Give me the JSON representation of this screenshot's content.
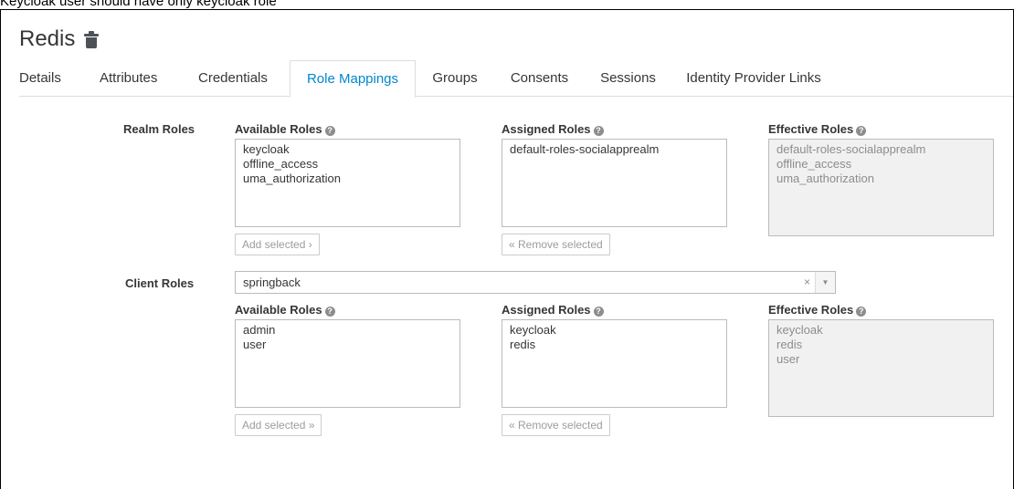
{
  "caption": "Keycloak user should have only keycloak role",
  "header": {
    "title": "Redis",
    "delete_icon": "trash-icon"
  },
  "tabs": [
    {
      "label": "Details",
      "active": false
    },
    {
      "label": "Attributes",
      "active": false
    },
    {
      "label": "Credentials",
      "active": false
    },
    {
      "label": "Role Mappings",
      "active": true
    },
    {
      "label": "Groups",
      "active": false
    },
    {
      "label": "Consents",
      "active": false
    },
    {
      "label": "Sessions",
      "active": false
    },
    {
      "label": "Identity Provider Links",
      "active": false
    }
  ],
  "realm_roles": {
    "label": "Realm Roles",
    "available": {
      "label": "Available Roles",
      "items": [
        "keycloak",
        "offline_access",
        "uma_authorization"
      ],
      "button": "Add selected ›"
    },
    "assigned": {
      "label": "Assigned Roles",
      "items": [
        "default-roles-socialapprealm"
      ],
      "button": "« Remove selected"
    },
    "effective": {
      "label": "Effective Roles",
      "items": [
        "default-roles-socialapprealm",
        "offline_access",
        "uma_authorization"
      ]
    }
  },
  "client_roles": {
    "label": "Client Roles",
    "client_select": {
      "value": "springback",
      "clear": "×",
      "arrow": "▼"
    },
    "available": {
      "label": "Available Roles",
      "items": [
        "admin",
        "user"
      ],
      "button": "Add selected »"
    },
    "assigned": {
      "label": "Assigned Roles",
      "items": [
        "keycloak",
        "redis"
      ],
      "button": "« Remove selected"
    },
    "effective": {
      "label": "Effective Roles",
      "items": [
        "keycloak",
        "redis",
        "user"
      ]
    }
  },
  "colors": {
    "accent": "#0088ce",
    "text": "#363636",
    "muted": "#8b8d8f",
    "readonly_bg": "#f1f1f1"
  }
}
